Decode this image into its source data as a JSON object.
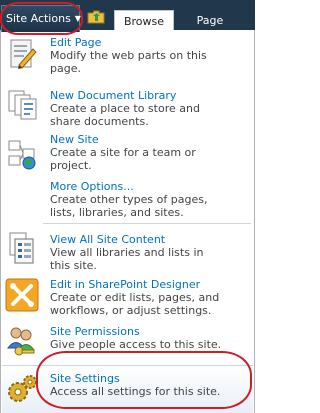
{
  "ribbon": {
    "site_actions_label": "Site Actions",
    "tabs": [
      {
        "label": "Browse"
      },
      {
        "label": "Page"
      }
    ]
  },
  "menu": {
    "items": [
      {
        "title": "Edit Page",
        "description": "Modify the web parts on this\npage.",
        "icon": "edit-page-icon"
      },
      {
        "title": "New Document Library",
        "description": "Create a place to store and\nshare documents.",
        "icon": "document-library-icon"
      },
      {
        "title": "New Site",
        "description": "Create a site for a team or\nproject.",
        "icon": "new-site-icon"
      },
      {
        "title": "More Options...",
        "description": "Create other types of pages,\nlists, libraries, and sites.",
        "icon": ""
      },
      {
        "title": "View All Site Content",
        "description": "View all libraries and lists in\nthis site.",
        "icon": "site-content-icon"
      },
      {
        "title": "Edit in SharePoint Designer",
        "description": "Create or edit lists, pages, and\nworkflows, or adjust settings.",
        "icon": "sharepoint-designer-icon"
      },
      {
        "title": "Site Permissions",
        "description": "Give people access to this site.",
        "icon": "permissions-icon"
      },
      {
        "title": "Site Settings",
        "description": "Access all settings for this site.",
        "icon": "gears-icon"
      }
    ]
  },
  "colors": {
    "ribbon_bg": "#21374c",
    "link": "#0072bc",
    "highlight_oval": "#cc1e25"
  }
}
